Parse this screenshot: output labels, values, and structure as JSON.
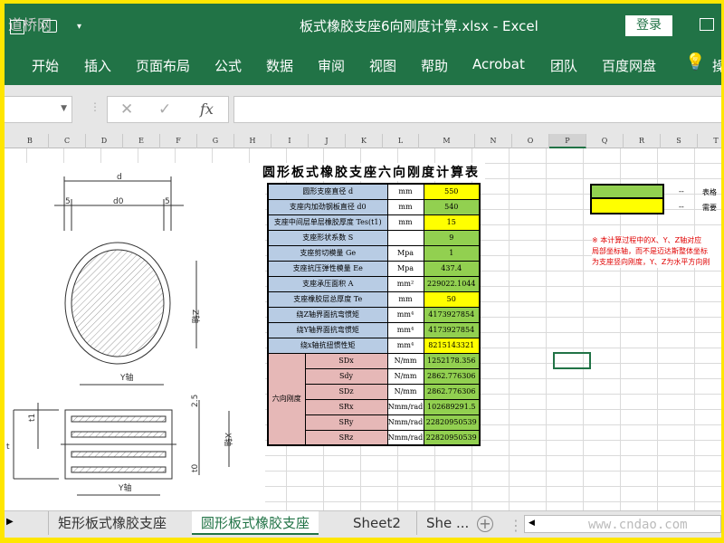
{
  "window": {
    "title": "板式橡胶支座6向刚度计算.xlsx  -  Excel",
    "login": "登录",
    "watermark": "道桥网"
  },
  "ribbon": {
    "tabs": [
      "开始",
      "插入",
      "页面布局",
      "公式",
      "数据",
      "审阅",
      "视图",
      "帮助",
      "Acrobat",
      "团队",
      "百度网盘",
      "操"
    ]
  },
  "formula_bar": {
    "cancel": "✕",
    "enter": "✓",
    "fx": "fx",
    "value": ""
  },
  "columns": [
    "B",
    "C",
    "D",
    "E",
    "F",
    "G",
    "H",
    "I",
    "J",
    "K",
    "L",
    "M",
    "N",
    "O",
    "P",
    "Q",
    "R",
    "S",
    "T"
  ],
  "selected_column": "P",
  "sheet": {
    "title": "圆形板式橡胶支座六向刚度计算表",
    "rows": [
      {
        "label": "圆形支座直径 d",
        "unit": "mm",
        "value": "550",
        "color": "y"
      },
      {
        "label": "支座内加劲钢板直径 d0",
        "unit": "mm",
        "value": "540",
        "color": "g"
      },
      {
        "label": "支座中间层单层橡胶厚度 Tes(t1)",
        "unit": "mm",
        "value": "15",
        "color": "y"
      },
      {
        "label": "支座形状系数 S",
        "unit": "",
        "value": "9",
        "color": "g"
      },
      {
        "label": "支座剪切模量 Ge",
        "unit": "Mpa",
        "value": "1",
        "color": "g"
      },
      {
        "label": "支座抗压弹性模量 Ee",
        "unit": "Mpa",
        "value": "437.4",
        "color": "g"
      },
      {
        "label": "支座承压面积 A",
        "unit": "mm²",
        "value": "229022.1044",
        "color": "g"
      },
      {
        "label": "支座橡胶层总厚度 Te",
        "unit": "mm",
        "value": "50",
        "color": "y"
      },
      {
        "label": "绕Z轴界面抗弯惯矩",
        "unit": "mm⁴",
        "value": "4173927854",
        "color": "g"
      },
      {
        "label": "绕Y轴界面抗弯惯矩",
        "unit": "mm⁴",
        "value": "4173927854",
        "color": "g"
      },
      {
        "label": "绕x轴抗扭惯性矩",
        "unit": "mm⁴",
        "value": "8215143321",
        "color": "y"
      }
    ],
    "stiffness_group": "六向刚度",
    "stiffness": [
      {
        "label": "SDx",
        "unit": "N/mm",
        "value": "1252178.356"
      },
      {
        "label": "Sdy",
        "unit": "N/mm",
        "value": "2862.776306"
      },
      {
        "label": "SDz",
        "unit": "N/mm",
        "value": "2862.776306"
      },
      {
        "label": "SRx",
        "unit": "Nmm/rad",
        "value": "102689291.5"
      },
      {
        "label": "SRy",
        "unit": "Nmm/rad",
        "value": "22820950539"
      },
      {
        "label": "SRz",
        "unit": "Nmm/rad",
        "value": "22820950539"
      }
    ],
    "legend": [
      {
        "dash": "--",
        "text": "表格",
        "color": "#92d050"
      },
      {
        "dash": "--",
        "text": "需要",
        "color": "#ffff00"
      }
    ],
    "note": [
      "※ 本计算过程中的X、Y、Z轴对应",
      "局部坐标轴，而不是迈达斯整体坐标",
      "为支座竖向刚度，Y、Z为水平方向刚"
    ]
  },
  "drawing": {
    "d": "d",
    "d0": "d0",
    "edge": "5",
    "z_axis": "Z轴",
    "y_axis": "Y轴",
    "x_axis": "X轴",
    "t": "t",
    "t1": "t1",
    "t0": "t0",
    "cover": "2.5"
  },
  "sheet_tabs": [
    "矩形板式橡胶支座",
    "圆形板式橡胶支座",
    "Sheet2",
    "She ..."
  ],
  "active_sheet_tab": 1,
  "footer_watermark": "www.cndao.com",
  "colors": {
    "excel_green": "#217346",
    "input_yellow": "#ffff00",
    "calc_green": "#92d050",
    "label_blue": "#b8cce4",
    "group_pink": "#e6b8b7"
  }
}
